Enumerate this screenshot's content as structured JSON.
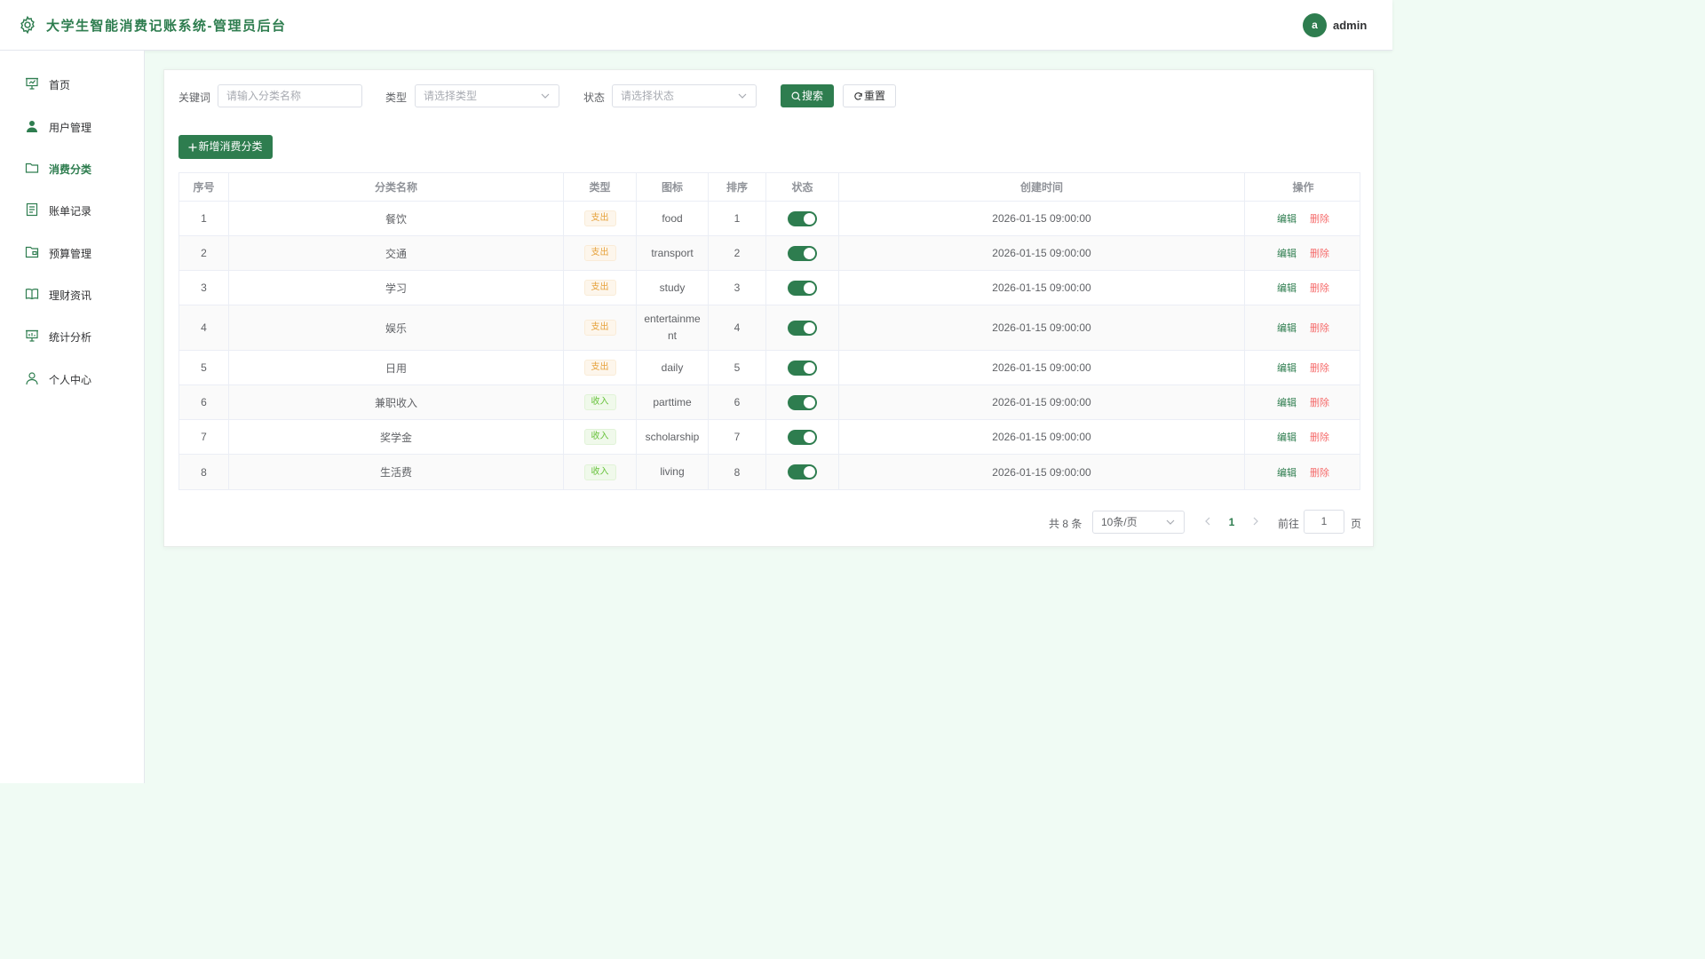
{
  "colors": {
    "primary": "#2e7d4f",
    "danger": "#f56c6c",
    "expense_tag": "#e6a23c",
    "income_tag": "#67c23a",
    "page_bg": "#f0fbf4"
  },
  "header": {
    "title": "大学生智能消费记账系统-管理员后台",
    "avatar_letter": "a",
    "username": "admin",
    "icon": "gear-icon"
  },
  "sidebar": {
    "items": [
      {
        "label": "首页",
        "icon": "presentation-icon",
        "active": false
      },
      {
        "label": "用户管理",
        "icon": "user-icon",
        "active": false
      },
      {
        "label": "消费分类",
        "icon": "folder-icon",
        "active": true
      },
      {
        "label": "账单记录",
        "icon": "document-icon",
        "active": false
      },
      {
        "label": "预算管理",
        "icon": "wallet-icon",
        "active": false
      },
      {
        "label": "理财资讯",
        "icon": "book-icon",
        "active": false
      },
      {
        "label": "统计分析",
        "icon": "chart-board-icon",
        "active": false
      },
      {
        "label": "个人中心",
        "icon": "person-outline-icon",
        "active": false
      }
    ]
  },
  "filters": {
    "keyword_label": "关键词",
    "keyword_placeholder": "请输入分类名称",
    "type_label": "类型",
    "type_placeholder": "请选择类型",
    "status_label": "状态",
    "status_placeholder": "请选择状态",
    "search_button": "搜索",
    "reset_button": "重置"
  },
  "add_button": "新增消费分类",
  "table": {
    "columns": [
      "序号",
      "分类名称",
      "类型",
      "图标",
      "排序",
      "状态",
      "创建时间",
      "操作"
    ],
    "rows": [
      {
        "index": "1",
        "name": "餐饮",
        "type": "支出",
        "icon": "food",
        "sort": "1",
        "enabled": true,
        "created": "2026-01-15 09:00:00"
      },
      {
        "index": "2",
        "name": "交通",
        "type": "支出",
        "icon": "transport",
        "sort": "2",
        "enabled": true,
        "created": "2026-01-15 09:00:00"
      },
      {
        "index": "3",
        "name": "学习",
        "type": "支出",
        "icon": "study",
        "sort": "3",
        "enabled": true,
        "created": "2026-01-15 09:00:00"
      },
      {
        "index": "4",
        "name": "娱乐",
        "type": "支出",
        "icon": "entertainment",
        "sort": "4",
        "enabled": true,
        "created": "2026-01-15 09:00:00"
      },
      {
        "index": "5",
        "name": "日用",
        "type": "支出",
        "icon": "daily",
        "sort": "5",
        "enabled": true,
        "created": "2026-01-15 09:00:00"
      },
      {
        "index": "6",
        "name": "兼职收入",
        "type": "收入",
        "icon": "parttime",
        "sort": "6",
        "enabled": true,
        "created": "2026-01-15 09:00:00"
      },
      {
        "index": "7",
        "name": "奖学金",
        "type": "收入",
        "icon": "scholarship",
        "sort": "7",
        "enabled": true,
        "created": "2026-01-15 09:00:00"
      },
      {
        "index": "8",
        "name": "生活费",
        "type": "收入",
        "icon": "living",
        "sort": "8",
        "enabled": true,
        "created": "2026-01-15 09:00:00"
      }
    ],
    "edit_label": "编辑",
    "delete_label": "删除"
  },
  "pagination": {
    "total_text": "共 8 条",
    "page_size": "10条/页",
    "current_page": "1",
    "goto_label": "前往",
    "goto_value": "1",
    "page_suffix": "页"
  }
}
